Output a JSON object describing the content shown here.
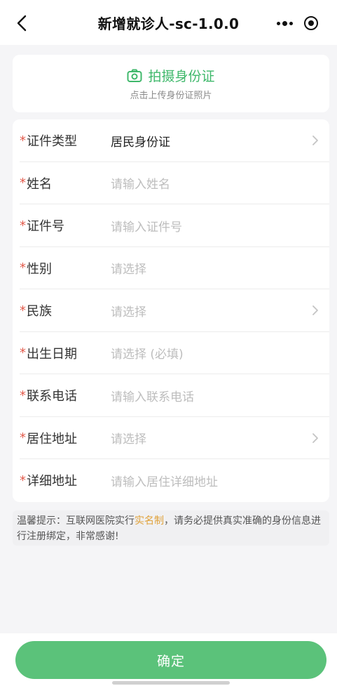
{
  "navbar": {
    "title": "新增就诊人-sc-1.0.0"
  },
  "upload": {
    "title": "拍摄身份证",
    "subtitle": "点击上传身份证照片"
  },
  "form": {
    "required_mark": "*",
    "rows": [
      {
        "label": "证件类型",
        "value": "居民身份证",
        "filled": true,
        "chevron": true
      },
      {
        "label": "姓名",
        "value": "请输入姓名",
        "filled": false,
        "chevron": false
      },
      {
        "label": "证件号",
        "value": "请输入证件号",
        "filled": false,
        "chevron": false
      },
      {
        "label": "性别",
        "value": "请选择",
        "filled": false,
        "chevron": false
      },
      {
        "label": "民族",
        "value": "请选择",
        "filled": false,
        "chevron": true
      },
      {
        "label": "出生日期",
        "value": "请选择 (必填)",
        "filled": false,
        "chevron": false
      },
      {
        "label": "联系电话",
        "value": "请输入联系电话",
        "filled": false,
        "chevron": false
      },
      {
        "label": "居住地址",
        "value": "请选择",
        "filled": false,
        "chevron": true
      },
      {
        "label": "详细地址",
        "value": "请输入居住详细地址",
        "filled": false,
        "chevron": false
      }
    ]
  },
  "tip": {
    "prefix": "温馨提示：互联网医院实行",
    "highlight": "实名制",
    "suffix": "，请务必提供真实准确的身份信息进行注册绑定，非常感谢!"
  },
  "footer": {
    "confirm_label": "确定"
  },
  "colors": {
    "accent": "#5bc27a",
    "required": "#e25b4c",
    "highlight": "#e0a23b"
  }
}
